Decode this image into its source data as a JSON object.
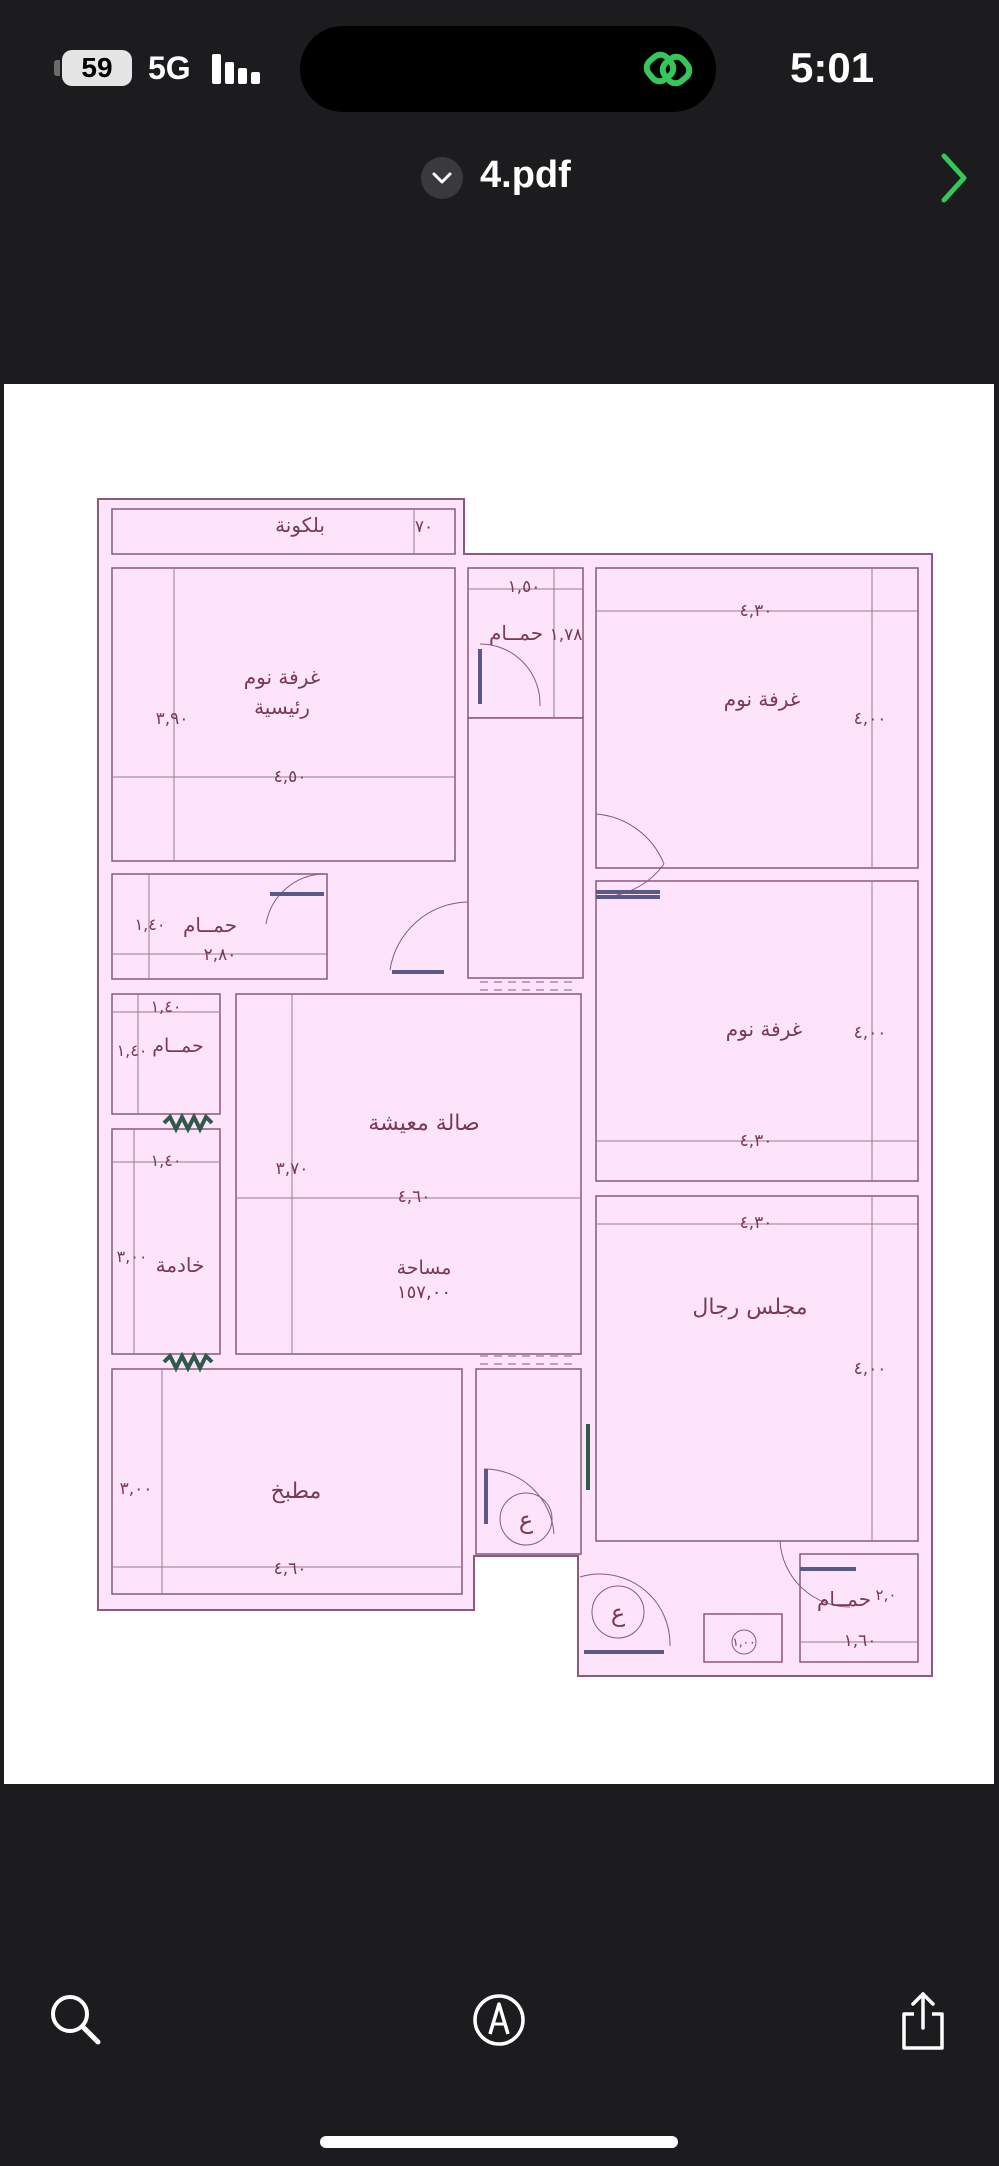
{
  "status_bar": {
    "battery": "59",
    "network": "5G",
    "time": "5:01"
  },
  "header": {
    "document_title": "4.pdf"
  },
  "floorplan": {
    "rooms": {
      "balcony": "بلكونة",
      "master_bedroom_line1": "غرفة نوم",
      "master_bedroom_line2": "رئيسية",
      "bedroom_top": "غرفة نوم",
      "bedroom_mid": "غرفة نوم",
      "bath_top": "حمــام",
      "bath_left": "حمــام",
      "bath_small": "حمــام",
      "living": "صالة معيشة",
      "maid": "خادمة",
      "area_label": "مساحة",
      "area_value": "١٥٧,٠٠",
      "majlis": "مجلس رجال",
      "kitchen": "مطبخ",
      "bath_right": "حمــام",
      "stair1": "ع",
      "stair2": "ع"
    },
    "dimensions": {
      "d_balcony_v": "٧٠",
      "d_bath_top_w": "١,٥٠",
      "d_bath_top_h": "١,٧٨",
      "d_bed_top_w": "٤,٣٠",
      "d_bed_top_h": "٤,٠٠",
      "d_master_h": "٣,٩٠",
      "d_master_w": "٤,٥٠",
      "d_bath_left_h": "١,٤٠",
      "d_bath_left_w": "٢,٨٠",
      "d_small_bath_w": "١,٤٠",
      "d_small_bath_h": "١,٤٠",
      "d_bed_mid_h": "٤,٠٠",
      "d_bed_mid_w": "٤,٣٠",
      "d_maid_w": "١,٤٠",
      "d_maid_h": "٣,٠٠",
      "d_living_h": "٣,٧٠",
      "d_living_w": "٤,٦٠",
      "d_majlis_w": "٤,٣٠",
      "d_majlis_h": "٤,٠٠",
      "d_kitchen_h": "٣,٠٠",
      "d_kitchen_w": "٤,٦٠",
      "d_bath_right_w": "١,٦٠",
      "d_bath_right_h": "٢,٠",
      "d_vent": "١,٠٠"
    }
  },
  "toolbar": {
    "search": "search-icon",
    "markup": "markup-icon",
    "share": "share-icon"
  },
  "colors": {
    "background": "#1c1c1e",
    "room_fill": "#fde4fb",
    "wall": "#8a5a7a",
    "accent_green": "#34c759"
  }
}
